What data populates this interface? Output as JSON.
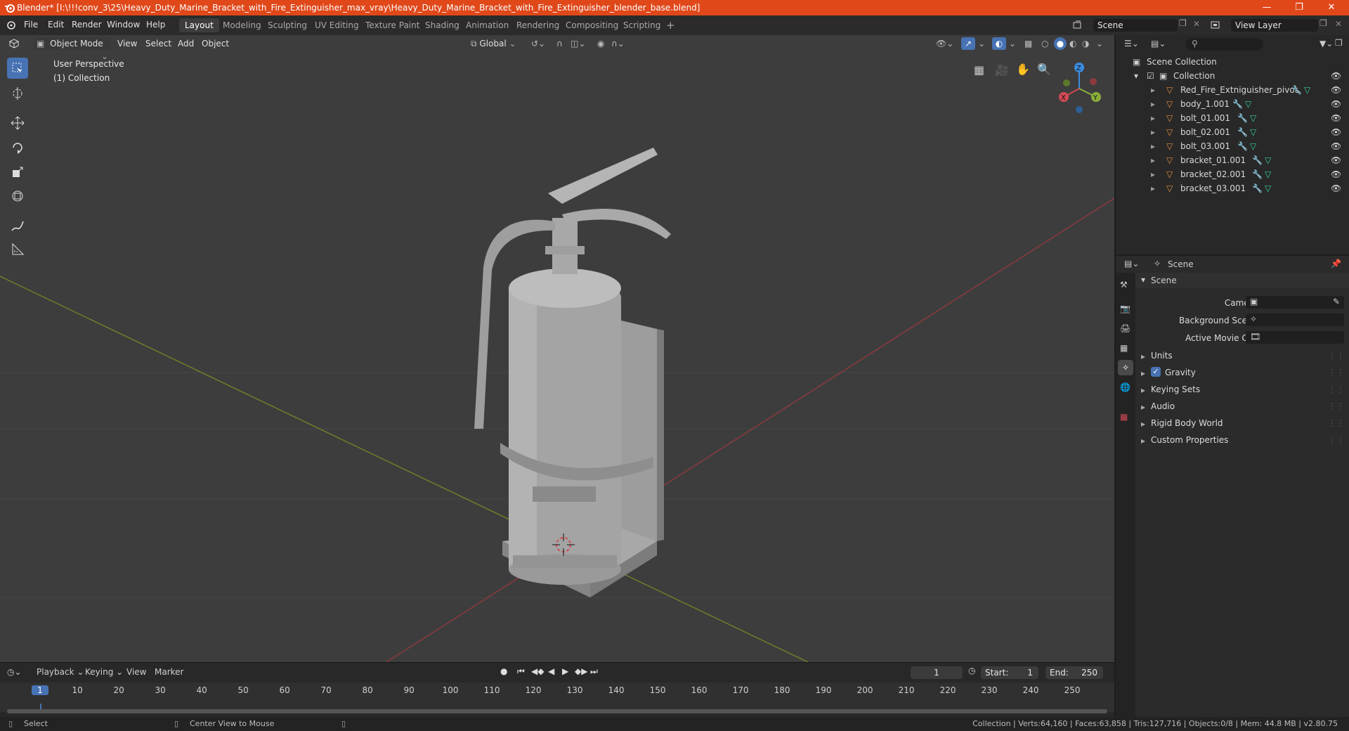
{
  "window": {
    "title": "Blender* [I:\\!!!conv_3\\25\\Heavy_Duty_Marine_Bracket_with_Fire_Extinguisher_max_vray\\Heavy_Duty_Marine_Bracket_with_Fire_Extinguisher_blender_base.blend]"
  },
  "menu": [
    "File",
    "Edit",
    "Render",
    "Window",
    "Help"
  ],
  "workspaces": [
    "Layout",
    "Modeling",
    "Sculpting",
    "UV Editing",
    "Texture Paint",
    "Shading",
    "Animation",
    "Rendering",
    "Compositing",
    "Scripting"
  ],
  "active_workspace": "Layout",
  "scene_field": "Scene",
  "view_layer_field": "View Layer",
  "viewport": {
    "mode": "Object Mode",
    "menus": [
      "View",
      "Select",
      "Add",
      "Object"
    ],
    "transform_orientation": "Global",
    "overlay_title": "User Perspective",
    "overlay_subtitle": "(1) Collection",
    "gizmo_axes": {
      "x": "X",
      "y": "Y",
      "z": "Z"
    }
  },
  "outliner": {
    "root": "Scene Collection",
    "collection": "Collection",
    "objects": [
      "Red_Fire_Extniguisher_pivot",
      "body_1.001",
      "bolt_01.001",
      "bolt_02.001",
      "bolt_03.001",
      "bracket_01.001",
      "bracket_02.001",
      "bracket_03.001"
    ]
  },
  "properties": {
    "context": "Scene",
    "panel": "Scene",
    "fields": {
      "camera": "Camera",
      "background_scene": "Background Scene",
      "active_movie_clip": "Active Movie Clip"
    },
    "sections": [
      "Units",
      "Gravity",
      "Keying Sets",
      "Audio",
      "Rigid Body World",
      "Custom Properties"
    ],
    "gravity_checked": true
  },
  "timeline": {
    "menus": [
      "Playback",
      "Keying",
      "View",
      "Marker"
    ],
    "current_frame": "1",
    "start_label": "Start:",
    "start": "1",
    "end_label": "End:",
    "end": "250",
    "ruler": [
      "1",
      "10",
      "20",
      "30",
      "40",
      "50",
      "60",
      "70",
      "80",
      "90",
      "100",
      "110",
      "120",
      "130",
      "140",
      "150",
      "160",
      "170",
      "180",
      "190",
      "200",
      "210",
      "220",
      "230",
      "240",
      "250"
    ]
  },
  "statusbar": {
    "left": "Select",
    "middle": "Center View to Mouse",
    "right": "Collection | Verts:64,160 | Faces:63,858 | Tris:127,716 | Objects:0/8 | Mem: 44.8 MB | v2.80.75"
  },
  "colors": {
    "titlebar": "#e0481a",
    "accent": "#4772b3",
    "viewport_bg": "#3d3d3d",
    "x_axis": "#d24a54",
    "y_axis": "#8aae3a",
    "z_axis": "#3b8de0",
    "mesh_orange": "#e08e3a",
    "modifier_blue": "#6ea8e8",
    "vertex_green": "#38d0a0"
  }
}
